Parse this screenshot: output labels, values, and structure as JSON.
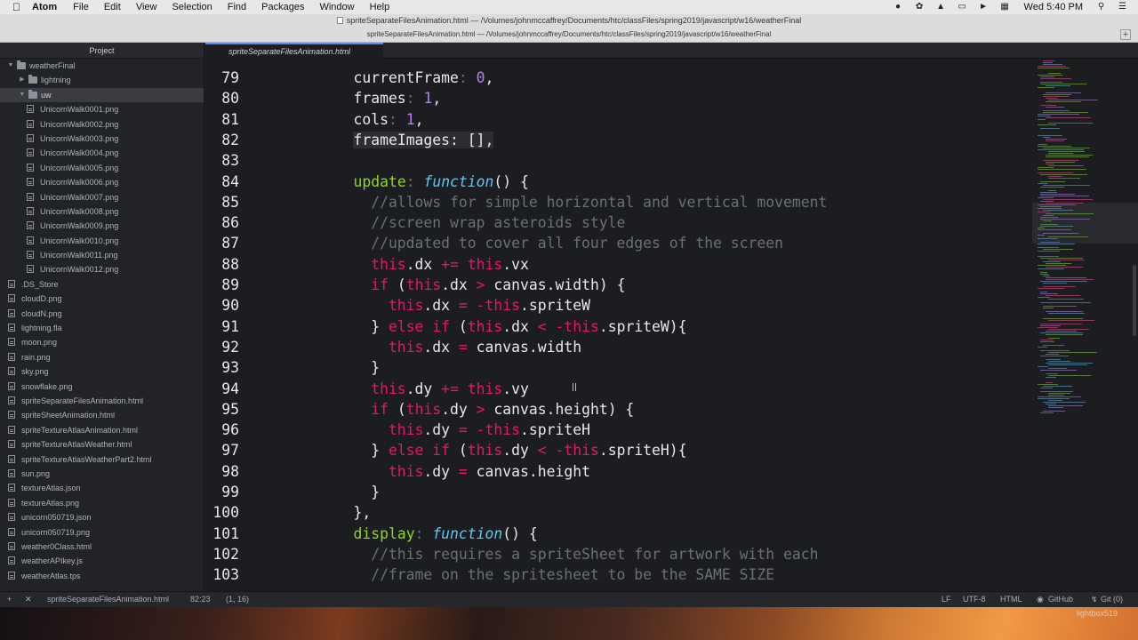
{
  "menubar": {
    "app": "Atom",
    "items": [
      "File",
      "Edit",
      "View",
      "Selection",
      "Find",
      "Packages",
      "Window",
      "Help"
    ],
    "clock": "Wed 5:40 PM",
    "status_icons": [
      "camera-icon",
      "creative-cloud-icon",
      "wifi-icon",
      "airplay-icon",
      "volume-icon",
      "keyboard-icon",
      "search-icon",
      "list-icon"
    ]
  },
  "window": {
    "title": "spriteSeparateFilesAnimation.html — /Volumes/johnmccaffrey/Documents/htc/classFiles/spring2019/javascript/w16/weatherFinal",
    "tab_path": "spriteSeparateFilesAnimation.html — /Volumes/johnmccaffrey/Documents/htc/classFiles/spring2019/javascript/w16/weatherFinal"
  },
  "tree": {
    "panel_title": "Project",
    "root": "weatherFinal",
    "folders": [
      "lightning",
      "uw"
    ],
    "uw_files": [
      "UnicornWalk0001.png",
      "UnicornWalk0002.png",
      "UnicornWalk0003.png",
      "UnicornWalk0004.png",
      "UnicornWalk0005.png",
      "UnicornWalk0006.png",
      "UnicornWalk0007.png",
      "UnicornWalk0008.png",
      "UnicornWalk0009.png",
      "UnicornWalk0010.png",
      "UnicornWalk0011.png",
      "UnicornWalk0012.png"
    ],
    "files": [
      ".DS_Store",
      "cloudD.png",
      "cloudN.png",
      "lightning.fla",
      "moon.png",
      "rain.png",
      "sky.png",
      "snowflake.png",
      "spriteSeparateFilesAnimation.html",
      "spriteSheetAnimation.html",
      "spriteTextureAtlasAnimation.html",
      "spriteTextureAtlasWeather.html",
      "spriteTextureAtlasWeatherPart2.html",
      "sun.png",
      "textureAtlas.json",
      "textureAtlas.png",
      "unicorn050719.json",
      "unicorn050719.png",
      "weather0Class.html",
      "weatherAPIkey.js",
      "weatherAtlas.tps"
    ]
  },
  "editor": {
    "tab_label": "spriteSeparateFilesAnimation.html",
    "lines": [
      {
        "n": "79",
        "parts": [
          [
            "",
            "    currentFrame"
          ],
          [
            "c",
            ":"
          ],
          [
            "",
            " "
          ],
          [
            "n",
            "0"
          ],
          [
            "",
            ","
          ]
        ]
      },
      {
        "n": "80",
        "parts": [
          [
            "",
            "    frames"
          ],
          [
            "c",
            ":"
          ],
          [
            "",
            " "
          ],
          [
            "n",
            "1"
          ],
          [
            "",
            ","
          ]
        ]
      },
      {
        "n": "81",
        "parts": [
          [
            "",
            "    cols"
          ],
          [
            "c",
            ":"
          ],
          [
            "",
            " "
          ],
          [
            "n",
            "1"
          ],
          [
            "",
            ","
          ]
        ]
      },
      {
        "n": "82",
        "parts": [
          [
            "",
            "    "
          ],
          [
            "hl",
            "frameImages: [],"
          ]
        ]
      },
      {
        "n": "83",
        "parts": []
      },
      {
        "n": "84",
        "parts": [
          [
            "",
            "    "
          ],
          [
            "f",
            "update"
          ],
          [
            "c",
            ":"
          ],
          [
            "",
            " "
          ],
          [
            "fn",
            "function"
          ],
          [
            "",
            "() {"
          ]
        ]
      },
      {
        "n": "85",
        "parts": [
          [
            "c",
            "      //allows for simple horizontal and vertical movement"
          ]
        ]
      },
      {
        "n": "86",
        "parts": [
          [
            "c",
            "      //screen wrap asteroids style"
          ]
        ]
      },
      {
        "n": "87",
        "parts": [
          [
            "c",
            "      //updated to cover all four edges of the screen"
          ]
        ]
      },
      {
        "n": "88",
        "parts": [
          [
            "k",
            "      this"
          ],
          [
            "",
            ".dx "
          ],
          [
            "k",
            "+="
          ],
          [
            "",
            " "
          ],
          [
            "k",
            "this"
          ],
          [
            "",
            ".vx"
          ]
        ]
      },
      {
        "n": "89",
        "parts": [
          [
            "k",
            "      if"
          ],
          [
            "",
            " ("
          ],
          [
            "k",
            "this"
          ],
          [
            "",
            ".dx "
          ],
          [
            "k",
            ">"
          ],
          [
            "",
            " canvas.width) {"
          ]
        ]
      },
      {
        "n": "90",
        "parts": [
          [
            "k",
            "        this"
          ],
          [
            "",
            ".dx "
          ],
          [
            "k",
            "="
          ],
          [
            "",
            " "
          ],
          [
            "k",
            "-this"
          ],
          [
            "",
            ".spriteW"
          ]
        ]
      },
      {
        "n": "91",
        "parts": [
          [
            "",
            "      } "
          ],
          [
            "k",
            "else if"
          ],
          [
            "",
            " ("
          ],
          [
            "k",
            "this"
          ],
          [
            "",
            ".dx "
          ],
          [
            "k",
            "<"
          ],
          [
            "",
            " "
          ],
          [
            "k",
            "-this"
          ],
          [
            "",
            ".spriteW){"
          ]
        ]
      },
      {
        "n": "92",
        "parts": [
          [
            "k",
            "        this"
          ],
          [
            "",
            ".dx "
          ],
          [
            "k",
            "="
          ],
          [
            "",
            " canvas.width"
          ]
        ]
      },
      {
        "n": "93",
        "parts": [
          [
            "",
            "      }"
          ]
        ]
      },
      {
        "n": "94",
        "parts": [
          [
            "k",
            "      this"
          ],
          [
            "",
            ".dy "
          ],
          [
            "k",
            "+="
          ],
          [
            "",
            " "
          ],
          [
            "k",
            "this"
          ],
          [
            "",
            ".vy"
          ]
        ]
      },
      {
        "n": "95",
        "parts": [
          [
            "k",
            "      if"
          ],
          [
            "",
            " ("
          ],
          [
            "k",
            "this"
          ],
          [
            "",
            ".dy "
          ],
          [
            "k",
            ">"
          ],
          [
            "",
            " canvas.height) {"
          ]
        ]
      },
      {
        "n": "96",
        "parts": [
          [
            "k",
            "        this"
          ],
          [
            "",
            ".dy "
          ],
          [
            "k",
            "="
          ],
          [
            "",
            " "
          ],
          [
            "k",
            "-this"
          ],
          [
            "",
            ".spriteH"
          ]
        ]
      },
      {
        "n": "97",
        "parts": [
          [
            "",
            "      } "
          ],
          [
            "k",
            "else if"
          ],
          [
            "",
            " ("
          ],
          [
            "k",
            "this"
          ],
          [
            "",
            ".dy "
          ],
          [
            "k",
            "<"
          ],
          [
            "",
            " "
          ],
          [
            "k",
            "-this"
          ],
          [
            "",
            ".spriteH){"
          ]
        ]
      },
      {
        "n": "98",
        "parts": [
          [
            "k",
            "        this"
          ],
          [
            "",
            ".dy "
          ],
          [
            "k",
            "="
          ],
          [
            "",
            " canvas.height"
          ]
        ]
      },
      {
        "n": "99",
        "parts": [
          [
            "",
            "      }"
          ]
        ]
      },
      {
        "n": "100",
        "parts": [
          [
            "",
            "    },"
          ]
        ]
      },
      {
        "n": "101",
        "parts": [
          [
            "",
            "    "
          ],
          [
            "f",
            "display"
          ],
          [
            "c",
            ":"
          ],
          [
            "",
            " "
          ],
          [
            "fn",
            "function"
          ],
          [
            "",
            "() {"
          ]
        ]
      },
      {
        "n": "102",
        "parts": [
          [
            "c",
            "      //this requires a spriteSheet for artwork with each"
          ]
        ]
      },
      {
        "n": "103",
        "parts": [
          [
            "c",
            "      //frame on the spritesheet to be the SAME SIZE"
          ]
        ]
      }
    ]
  },
  "statusbar": {
    "file": "spriteSeparateFilesAnimation.html",
    "cursor": "82:23",
    "selection": "(1, 16)",
    "line_ending": "LF",
    "encoding": "UTF-8",
    "grammar": "HTML",
    "github": "GitHub",
    "git": "Git (0)"
  },
  "desktop": {
    "watermark": "lightbox519"
  },
  "colors": {
    "keyword": "#e6166c",
    "function_name": "#8fd81f",
    "function_keyword": "#59c8f5",
    "number": "#b97bf5",
    "comment": "#6b6f76",
    "accent": "#568af2"
  }
}
